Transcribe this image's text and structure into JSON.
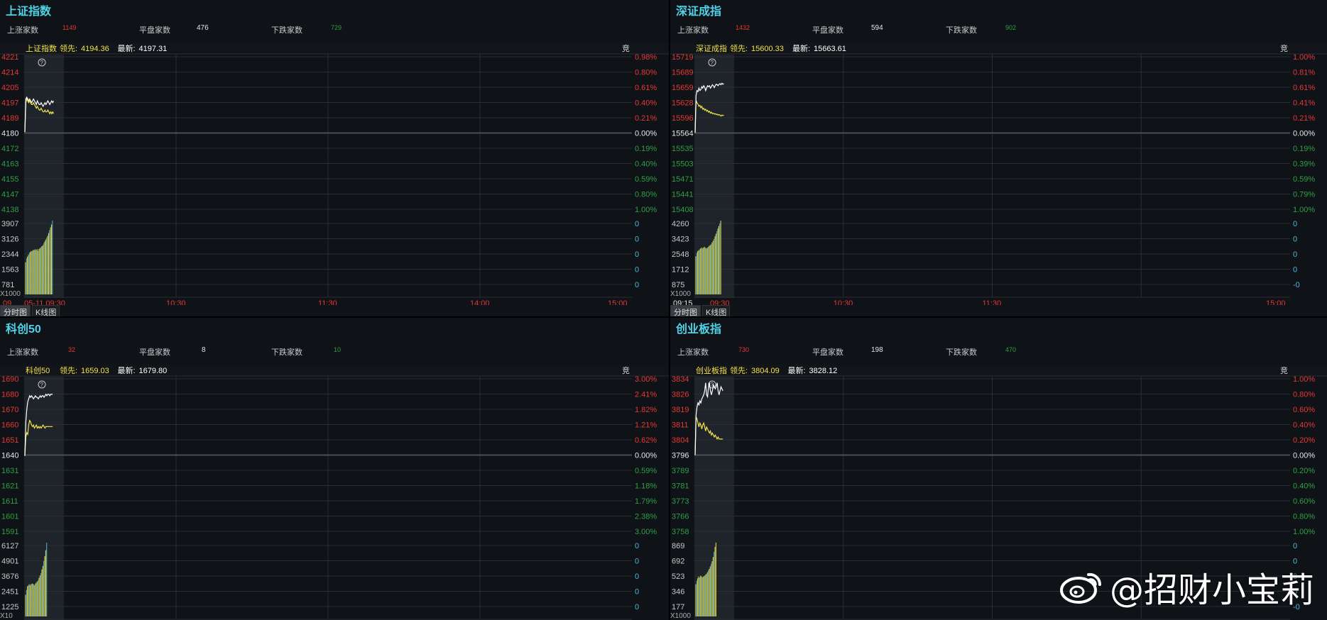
{
  "colors": {
    "up": "#e53935",
    "down": "#2ea043",
    "neutral": "#e6e6e6",
    "title": "#4fd3e8",
    "leader_line": "#f2e34a",
    "price_line": "#ffffff",
    "volume_up": "#f2e34a",
    "volume_down": "#4fb5e0",
    "grid": "#2a2e34",
    "pct_zero_right": "#4fb5e0"
  },
  "watermark": {
    "text": "@招财小宝莉",
    "icon": "weibo-icon"
  },
  "chart_data": [
    {
      "type": "line",
      "title": "上证指数",
      "stats": {
        "up_label": "上涨家数",
        "up": "1149",
        "flat_label": "平盘家数",
        "flat": "476",
        "down_label": "下跌家数",
        "down": "729"
      },
      "header": {
        "name": "上证指数",
        "leader_label": "领先:",
        "leader": "4194.36",
        "latest_label": "最新:",
        "latest": "4197.31",
        "corner": "竞"
      },
      "price_ticks": [
        "4221",
        "4214",
        "4205",
        "4197",
        "4189",
        "4180",
        "4172",
        "4163",
        "4155",
        "4147",
        "4138"
      ],
      "pct_ticks": [
        "0.98%",
        "0.80%",
        "0.61%",
        "0.40%",
        "0.21%",
        "0.00%",
        "0.19%",
        "0.40%",
        "0.59%",
        "0.80%",
        "1.00%"
      ],
      "volume_ticks": [
        "3907",
        "3126",
        "2344",
        "1563",
        "781"
      ],
      "volume_right_ticks": [
        "0",
        "0",
        "0",
        "0",
        "0"
      ],
      "volume_unit": "X1000",
      "time_ticks": [
        "05-11 09:30",
        "10:30",
        "11:30",
        "14:00",
        "15:00"
      ],
      "time_prefix": "09",
      "ylim": [
        4138,
        4221
      ],
      "base": 4180,
      "price": [
        4180,
        4198,
        4199,
        4198,
        4197,
        4198,
        4197,
        4196,
        4197,
        4198,
        4197,
        4196,
        4195,
        4197,
        4196,
        4195,
        4195,
        4196,
        4195,
        4194,
        4195,
        4196,
        4195,
        4196,
        4197,
        4196,
        4195,
        4196,
        4197,
        4196,
        4197
      ],
      "leader": [
        4180,
        4196,
        4198,
        4197,
        4196,
        4197,
        4196,
        4195,
        4195,
        4196,
        4195,
        4194,
        4193,
        4194,
        4193,
        4192,
        4192,
        4193,
        4192,
        4191,
        4191,
        4192,
        4191,
        4191,
        4192,
        4191,
        4190,
        4191,
        4190,
        4191,
        4190
      ],
      "volume": [
        1700,
        1900,
        2000,
        2100,
        2200,
        2250,
        2300,
        2300,
        2350,
        2350,
        2400,
        2350,
        2400,
        2300,
        2400,
        2450,
        2500,
        2550,
        2600,
        2700,
        2800,
        2900,
        3000,
        3100,
        3250,
        3400,
        3550,
        3700,
        3907
      ],
      "vol_max": 3907,
      "tabs": [
        "分时图",
        "K线图"
      ]
    },
    {
      "type": "line",
      "title": "深证成指",
      "stats": {
        "up_label": "上涨家数",
        "up": "1432",
        "flat_label": "平盘家数",
        "flat": "594",
        "down_label": "下跌家数",
        "down": "902"
      },
      "header": {
        "name": "深证成指",
        "leader_label": "领先:",
        "leader": "15600.33",
        "latest_label": "最新:",
        "latest": "15663.61",
        "corner": "竞"
      },
      "price_ticks": [
        "15719",
        "15689",
        "15659",
        "15628",
        "15596",
        "15564",
        "15535",
        "15503",
        "15471",
        "15441",
        "15408"
      ],
      "pct_ticks": [
        "1.00%",
        "0.81%",
        "0.61%",
        "0.41%",
        "0.21%",
        "0.00%",
        "0.19%",
        "0.39%",
        "0.59%",
        "0.79%",
        "1.00%"
      ],
      "volume_ticks": [
        "4260",
        "3423",
        "2548",
        "1712",
        "875"
      ],
      "volume_right_ticks": [
        "0",
        "0",
        "0",
        "0",
        "-0"
      ],
      "volume_unit": "X1000",
      "time_ticks": [
        "09:15",
        "09:30",
        "10:30",
        "11:30",
        "15:00"
      ],
      "time_prefix": "",
      "ylim": [
        15408,
        15719
      ],
      "base": 15564,
      "price": [
        15564,
        15640,
        15650,
        15648,
        15655,
        15650,
        15652,
        15658,
        15655,
        15660,
        15657,
        15650,
        15655,
        15660,
        15658,
        15660,
        15655,
        15658,
        15662,
        15660,
        15656,
        15660,
        15663,
        15662,
        15660,
        15663,
        15664,
        15662,
        15665,
        15663,
        15664
      ],
      "leader": [
        15564,
        15630,
        15625,
        15622,
        15618,
        15620,
        15615,
        15618,
        15612,
        15614,
        15610,
        15612,
        15608,
        15610,
        15606,
        15608,
        15604,
        15606,
        15603,
        15604,
        15602,
        15603,
        15601,
        15602,
        15600,
        15601,
        15600,
        15598,
        15600,
        15599,
        15600
      ],
      "volume": [
        2200,
        2400,
        2500,
        2550,
        2600,
        2650,
        2700,
        2650,
        2700,
        2750,
        2700,
        2650,
        2700,
        2750,
        2800,
        2850,
        2900,
        3000,
        3100,
        3200,
        3350,
        3500,
        3650,
        3800,
        3950,
        4100,
        4260
      ],
      "vol_max": 4260,
      "tabs": [
        "分时图",
        "K线图"
      ]
    },
    {
      "type": "line",
      "title": "科创50",
      "stats": {
        "up_label": "上涨家数",
        "up": "32",
        "flat_label": "平盘家数",
        "flat": "8",
        "down_label": "下跌家数",
        "down": "10"
      },
      "header": {
        "name": "科创50",
        "leader_label": "领先:",
        "leader": "1659.03",
        "latest_label": "最新:",
        "latest": "1679.80",
        "corner": "竞"
      },
      "price_ticks": [
        "1690",
        "1680",
        "1670",
        "1660",
        "1651",
        "1640",
        "1631",
        "1621",
        "1611",
        "1601",
        "1591"
      ],
      "pct_ticks": [
        "3.00%",
        "2.41%",
        "1.82%",
        "1.21%",
        "0.62%",
        "0.00%",
        "0.59%",
        "1.18%",
        "1.79%",
        "2.38%",
        "3.00%"
      ],
      "volume_ticks": [
        "6127",
        "4901",
        "3676",
        "2451",
        "1225"
      ],
      "volume_right_ticks": [
        "0",
        "0",
        "0",
        "0",
        "0"
      ],
      "volume_unit": "X10",
      "time_ticks": [],
      "time_prefix": "",
      "ylim": [
        1591,
        1690
      ],
      "base": 1640,
      "price": [
        1640,
        1662,
        1670,
        1675,
        1677,
        1679,
        1678,
        1679,
        1678,
        1677,
        1678,
        1679,
        1678,
        1678,
        1677,
        1678,
        1679,
        1678,
        1679,
        1679,
        1678,
        1679,
        1680,
        1679,
        1680,
        1680,
        1679,
        1680,
        1680,
        1680
      ],
      "leader": [
        1640,
        1652,
        1655,
        1654,
        1660,
        1663,
        1662,
        1660,
        1659,
        1660,
        1658,
        1659,
        1660,
        1658,
        1659,
        1658,
        1659,
        1658,
        1659,
        1660,
        1659,
        1658,
        1659,
        1659,
        1659,
        1659,
        1659,
        1659,
        1659,
        1659
      ],
      "volume": [
        1800,
        2200,
        2500,
        2600,
        2700,
        2600,
        2700,
        2750,
        2700,
        2600,
        2700,
        2800,
        2900,
        3000,
        3200,
        3400,
        3600,
        3900,
        4200,
        4600,
        5000,
        5500,
        6127
      ],
      "vol_max": 6127,
      "tabs": []
    },
    {
      "type": "line",
      "title": "创业板指",
      "stats": {
        "up_label": "上涨家数",
        "up": "730",
        "flat_label": "平盘家数",
        "flat": "198",
        "down_label": "下跌家数",
        "down": "470"
      },
      "header": {
        "name": "创业板指",
        "leader_label": "领先:",
        "leader": "3804.09",
        "latest_label": "最新:",
        "latest": "3828.12",
        "corner": "竞"
      },
      "price_ticks": [
        "3834",
        "3826",
        "3819",
        "3811",
        "3804",
        "3796",
        "3789",
        "3781",
        "3773",
        "3766",
        "3758"
      ],
      "pct_ticks": [
        "1.00%",
        "0.80%",
        "0.60%",
        "0.40%",
        "0.20%",
        "0.00%",
        "0.20%",
        "0.40%",
        "0.60%",
        "0.80%",
        "1.00%"
      ],
      "volume_ticks": [
        "869",
        "692",
        "523",
        "346",
        "177"
      ],
      "volume_right_ticks": [
        "0",
        "0",
        "0",
        "0",
        "-0"
      ],
      "volume_unit": "X1000",
      "time_ticks": [],
      "time_prefix": "",
      "ylim": [
        3758,
        3834
      ],
      "base": 3796,
      "price": [
        3796,
        3816,
        3820,
        3822,
        3821,
        3823,
        3822,
        3824,
        3825,
        3826,
        3828,
        3832,
        3826,
        3825,
        3830,
        3832,
        3828,
        3826,
        3828,
        3831,
        3830,
        3829,
        3830,
        3832,
        3828,
        3826,
        3828,
        3830,
        3829,
        3828
      ],
      "leader": [
        3796,
        3815,
        3814,
        3812,
        3810,
        3812,
        3811,
        3809,
        3811,
        3812,
        3810,
        3808,
        3810,
        3809,
        3808,
        3807,
        3808,
        3806,
        3807,
        3806,
        3805,
        3806,
        3805,
        3804,
        3805,
        3804,
        3804,
        3804,
        3804,
        3804
      ],
      "volume": [
        380,
        420,
        450,
        470,
        460,
        480,
        470,
        460,
        470,
        480,
        490,
        500,
        520,
        540,
        560,
        590,
        620,
        650,
        700,
        760,
        820,
        869
      ],
      "vol_max": 869,
      "tabs": []
    }
  ]
}
